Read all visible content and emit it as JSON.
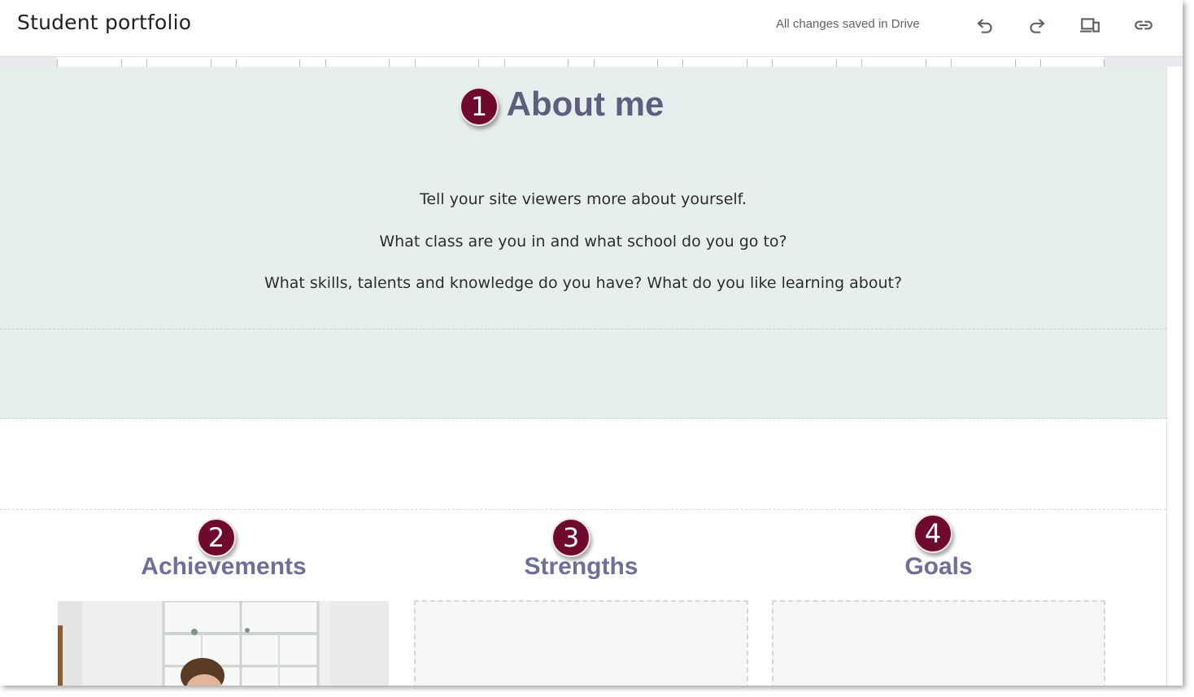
{
  "app": {
    "title": "Student portfolio",
    "save_status": "All changes saved in Drive"
  },
  "toolbar": {
    "icons": [
      "undo-icon",
      "redo-icon",
      "preview-devices-icon",
      "link-icon"
    ]
  },
  "about": {
    "title": "About me",
    "lines": [
      "Tell your site viewers more about yourself.",
      "What class are you in and what school do you go to?",
      "What skills, talents and knowledge do you have? What do you like learning about?"
    ]
  },
  "columns": [
    {
      "heading": "Achievements"
    },
    {
      "heading": "Strengths"
    },
    {
      "heading": "Goals"
    }
  ],
  "callouts": [
    "1",
    "2",
    "3",
    "4"
  ],
  "colors": {
    "about_bg": "#e7efee",
    "heading": "#6d6f99",
    "about_heading": "#5c5f7d",
    "badge": "#6e0a2e"
  }
}
